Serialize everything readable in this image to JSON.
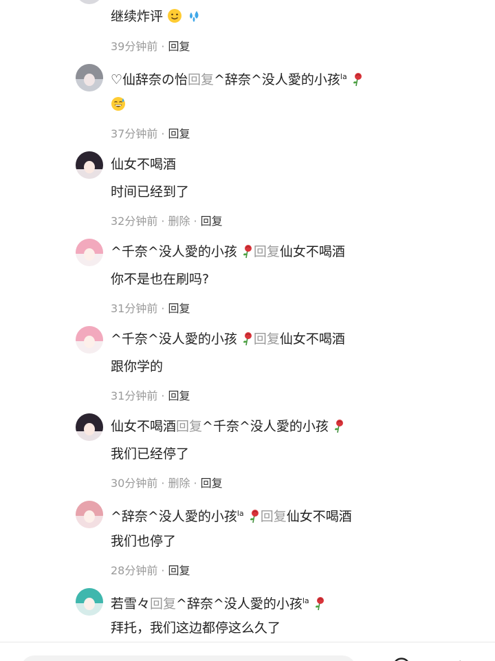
{
  "comments": [
    {
      "line1_text": "继续炸评",
      "line1_emojis": [
        "slightly-smiling-face",
        "sweat-droplets"
      ],
      "time": "39分钟前",
      "reply": "回复"
    },
    {
      "author": "♡仙辞奈の怡",
      "reply_word": "回复",
      "target": "^辞奈^没人愛的小孩",
      "target_suffix": "la",
      "line2_emoji": "grinning-face-with-sweat",
      "time": "37分钟前",
      "reply": "回复"
    },
    {
      "author": "仙女不喝酒",
      "text": "时间已经到了",
      "time": "32分钟前",
      "delete": "删除",
      "reply": "回复"
    },
    {
      "author": "^千奈^没人愛的小孩",
      "reply_word": "回复",
      "target": "仙女不喝酒",
      "text": "你不是也在刷吗?",
      "time": "31分钟前",
      "reply": "回复"
    },
    {
      "author": "^千奈^没人愛的小孩",
      "reply_word": "回复",
      "target": "仙女不喝酒",
      "text": "跟你学的",
      "time": "31分钟前",
      "reply": "回复"
    },
    {
      "author": "仙女不喝酒",
      "reply_word": "回复",
      "target": "^千奈^没人愛的小孩",
      "text": "我们已经停了",
      "time": "30分钟前",
      "delete": "删除",
      "reply": "回复"
    },
    {
      "author": "^辞奈^没人愛的小孩",
      "author_suffix": "la",
      "reply_word": "回复",
      "target": "仙女不喝酒",
      "text": "我们也停了",
      "time": "28分钟前",
      "reply": "回复"
    },
    {
      "author": "若雪々",
      "reply_word": "回复",
      "target": "^辞奈^没人愛的小孩",
      "target_suffix": "la",
      "text": "拜托，我们这边都停这么久了"
    }
  ],
  "colors": {
    "text": "#222222",
    "muted": "#9a9a9a",
    "rose": "#d9343a"
  },
  "icons": [
    "rose-icon",
    "comment-input",
    "emoji-icon",
    "share-icon"
  ]
}
